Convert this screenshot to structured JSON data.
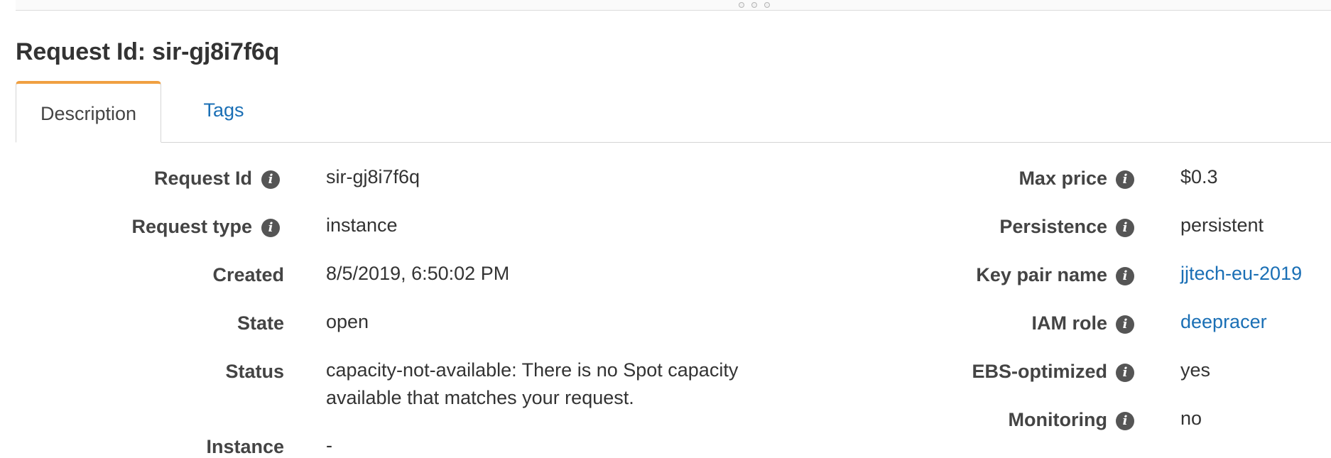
{
  "page": {
    "title": "Request Id: sir-gj8i7f6q"
  },
  "tabs": [
    {
      "label": "Description",
      "active": true
    },
    {
      "label": "Tags",
      "active": false
    }
  ],
  "details_left": [
    {
      "label": "Request Id",
      "value": "sir-gj8i7f6q",
      "has_info": true
    },
    {
      "label": "Request type",
      "value": "instance",
      "has_info": true
    },
    {
      "label": "Created",
      "value": "8/5/2019, 6:50:02 PM",
      "has_info": false
    },
    {
      "label": "State",
      "value": "open",
      "has_info": false
    },
    {
      "label": "Status",
      "value": "capacity-not-available: There is no Spot capacity available that matches your request.",
      "has_info": false
    },
    {
      "label": "Instance",
      "value": "-",
      "has_info": false
    }
  ],
  "details_right": [
    {
      "label": "Max price",
      "value": "$0.3",
      "has_info": true,
      "is_link": false
    },
    {
      "label": "Persistence",
      "value": "persistent",
      "has_info": true,
      "is_link": false
    },
    {
      "label": "Key pair name",
      "value": "jjtech-eu-2019",
      "has_info": true,
      "is_link": true
    },
    {
      "label": "IAM role",
      "value": "deepracer",
      "has_info": true,
      "is_link": true
    },
    {
      "label": "EBS-optimized",
      "value": "yes",
      "has_info": true,
      "is_link": false
    },
    {
      "label": "Monitoring",
      "value": "no",
      "has_info": true,
      "is_link": false
    }
  ],
  "icons": {
    "info_glyph": "i"
  },
  "colors": {
    "tab_accent": "#f0a042",
    "link": "#1a6fb5",
    "info_icon": "#555555"
  }
}
